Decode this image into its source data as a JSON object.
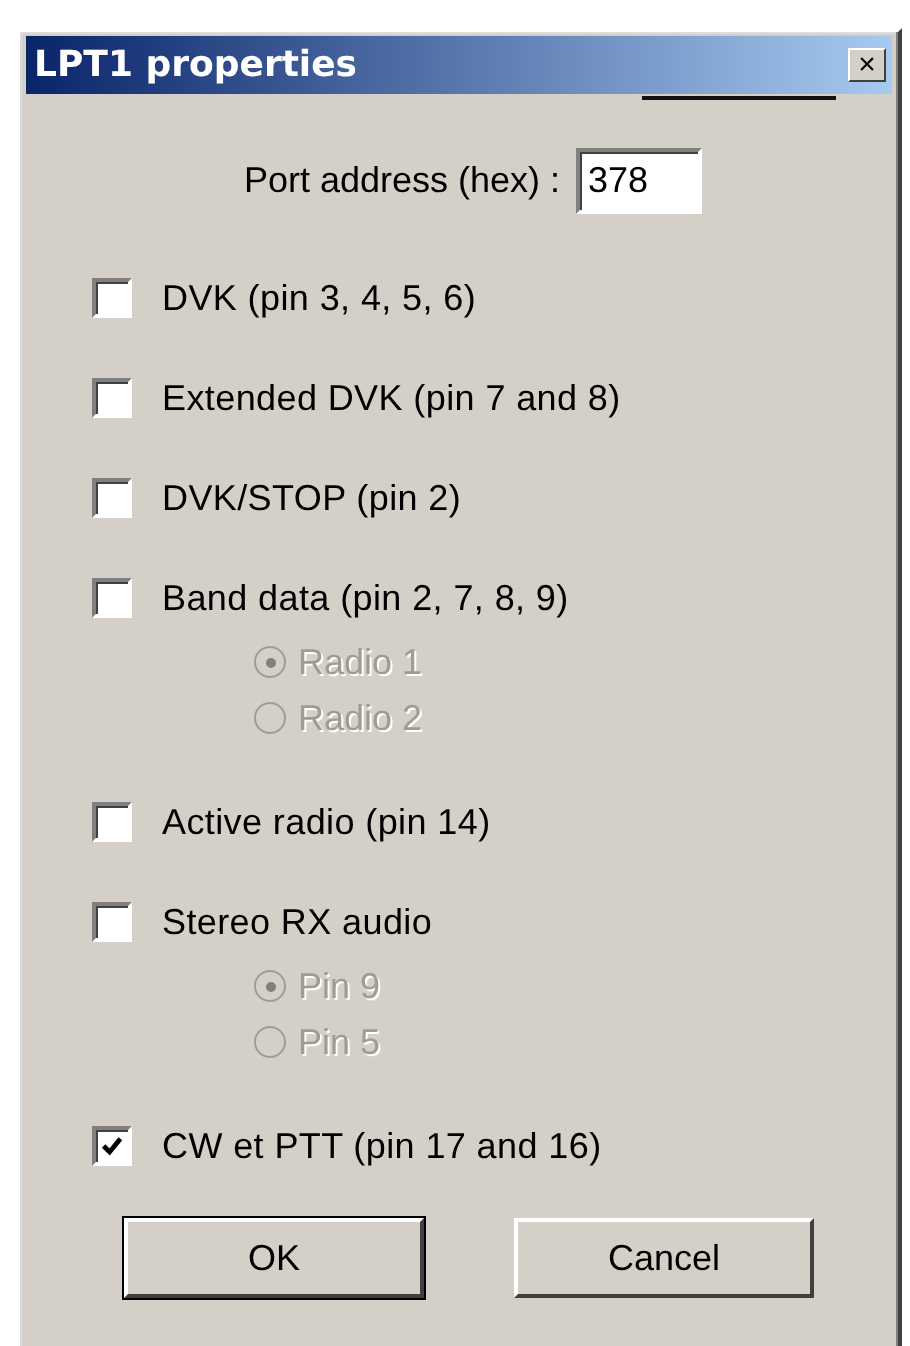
{
  "window": {
    "title": "LPT1 properties",
    "close": "×"
  },
  "port_address": {
    "label": "Port address (hex) :",
    "value": "378"
  },
  "options": [
    {
      "label": "DVK (pin 3, 4, 5, 6)",
      "checked": false
    },
    {
      "label": "Extended DVK (pin 7 and 8)",
      "checked": false
    },
    {
      "label": "DVK/STOP (pin 2)",
      "checked": false
    },
    {
      "label": "Band data (pin 2, 7, 8, 9)",
      "checked": false,
      "radios": [
        {
          "label": "Radio 1",
          "selected": true,
          "disabled": true
        },
        {
          "label": "Radio 2",
          "selected": false,
          "disabled": true
        }
      ]
    },
    {
      "label": "Active radio (pin 14)",
      "checked": false
    },
    {
      "label": "Stereo RX audio",
      "checked": false,
      "radios": [
        {
          "label": "Pin 9",
          "selected": true,
          "disabled": true
        },
        {
          "label": "Pin 5",
          "selected": false,
          "disabled": true
        }
      ]
    },
    {
      "label": "CW et PTT (pin 17 and 16)",
      "checked": true
    }
  ],
  "buttons": [
    {
      "label": "OK",
      "default": true
    },
    {
      "label": "Cancel",
      "default": false
    }
  ]
}
